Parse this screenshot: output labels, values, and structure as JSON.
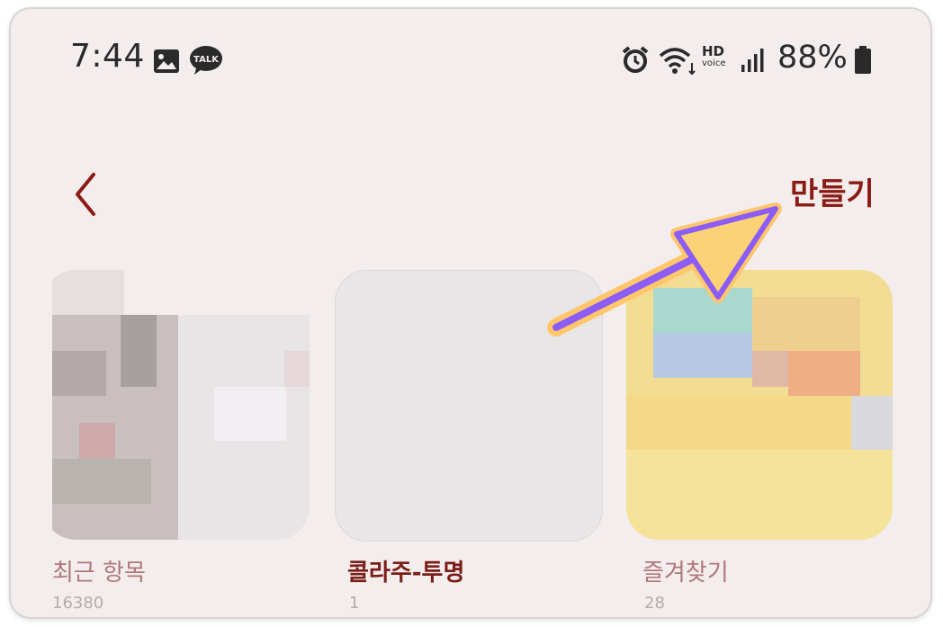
{
  "status_bar": {
    "time": "7:44",
    "hd_label": "HD",
    "hd_sub": "voice",
    "battery": "88%",
    "icons": [
      "image-icon",
      "talk-icon",
      "alarm-icon",
      "wifi-icon",
      "signal-icon",
      "battery-icon"
    ]
  },
  "header": {
    "back_icon": "chevron-left-icon",
    "create_label": "만들기"
  },
  "albums": [
    {
      "name": "최근 항목",
      "count": "16380"
    },
    {
      "name": "콜라주-투명",
      "count": "1"
    },
    {
      "name": "즐겨찾기",
      "count": "28"
    }
  ],
  "colors": {
    "accent": "#8b1a14",
    "label_muted": "#b0787a",
    "background": "#f3eded",
    "annotation_arrow": "#8b5cf6",
    "annotation_outline": "#ffc66b"
  }
}
